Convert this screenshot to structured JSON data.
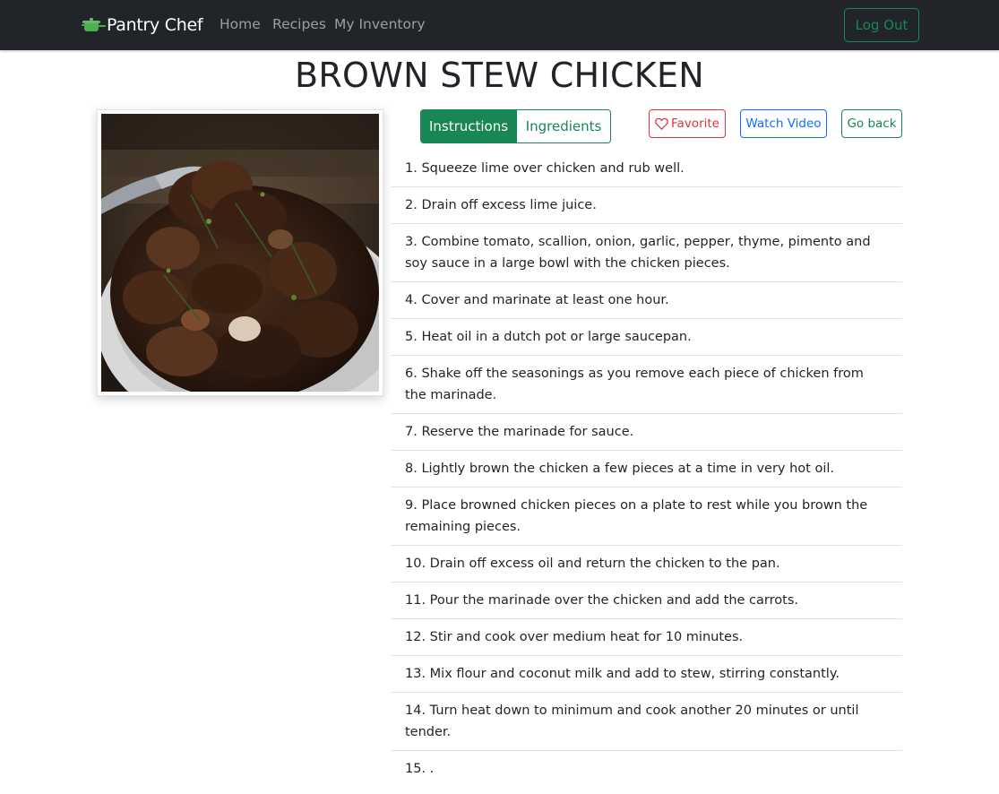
{
  "navbar": {
    "brand": "Pantry Chef",
    "brand_icon": "pot-icon",
    "links": [
      "Home",
      "Recipes",
      "My Inventory"
    ],
    "logout_label": "Log Out"
  },
  "recipe": {
    "title": "BROWN STEW CHICKEN",
    "tabs": {
      "instructions": "Instructions",
      "ingredients": "Ingredients"
    },
    "active_tab": "Instructions",
    "favorite_label": "Favorite",
    "watch_video_label": "Watch Video",
    "go_back_label": "Go back",
    "steps": [
      "1. Squeeze lime over chicken and rub well.",
      "2. Drain off excess lime juice.",
      "3. Combine tomato, scallion, onion, garlic, pepper, thyme, pimento and soy sauce in a large bowl with the chicken pieces.",
      "4. Cover and marinate at least one hour.",
      "5. Heat oil in a dutch pot or large saucepan.",
      "6. Shake off the seasonings as you remove each piece of chicken from the marinade.",
      "7. Reserve the marinade for sauce.",
      "8. Lightly brown the chicken a few pieces at a time in very hot oil.",
      "9. Place browned chicken pieces on a plate to rest while you brown the remaining pieces.",
      "10. Drain off excess oil and return the chicken to the pan.",
      "11. Pour the marinade over the chicken and add the carrots.",
      "12. Stir and cook over medium heat for 10 minutes.",
      "13. Mix flour and coconut milk and add to stew, stirring constantly.",
      "14. Turn heat down to minimum and cook another 20 minutes or until tender.",
      "15. ."
    ]
  },
  "colors": {
    "navbar_bg": "#212529",
    "success": "#198754",
    "danger": "#dc3545",
    "primary": "#0d6efd"
  }
}
